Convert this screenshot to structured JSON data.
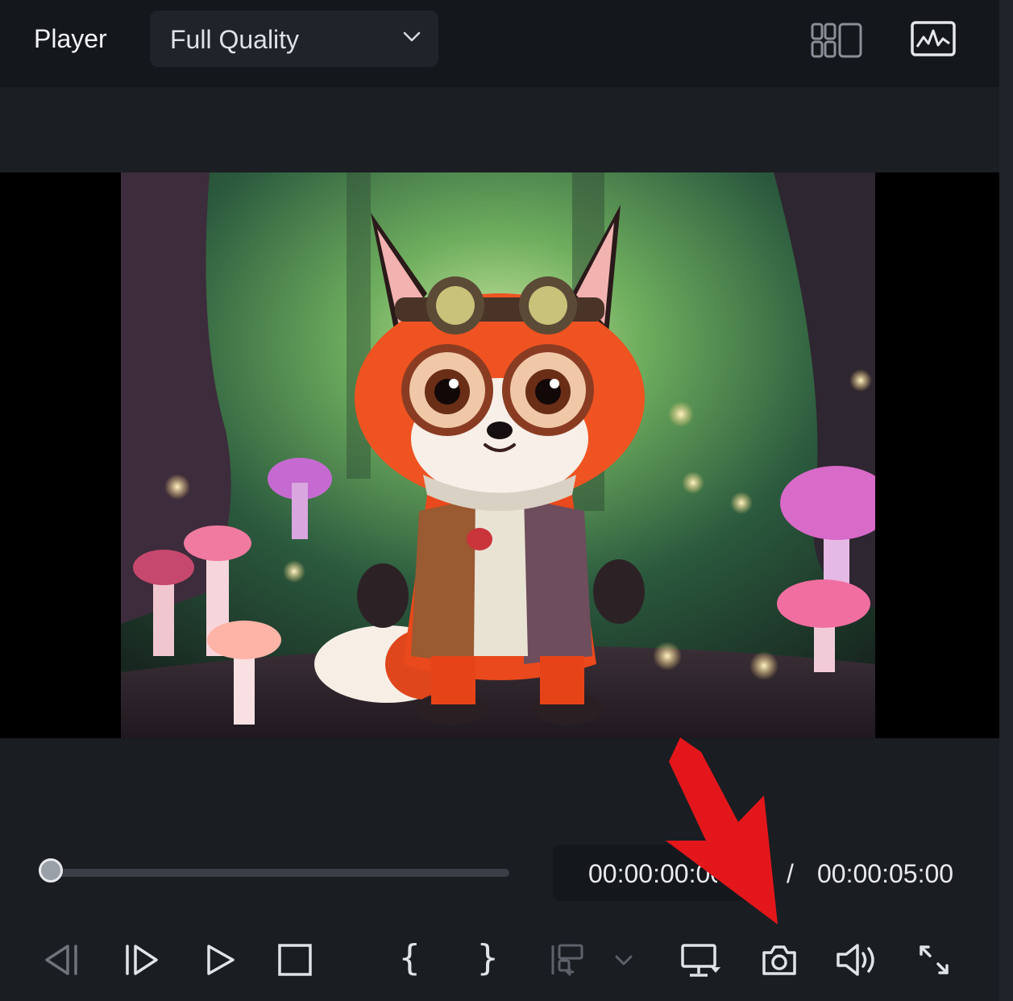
{
  "header": {
    "title": "Player",
    "quality": {
      "selected": "Full Quality"
    },
    "icons": [
      "grid-layout-icon",
      "waveform-image-icon"
    ]
  },
  "playback": {
    "current_time": "00:00:00:00",
    "separator": "/",
    "total_time": "00:00:05:00",
    "progress": 0.0
  },
  "controls": {
    "mark_in": "{",
    "mark_out": "}",
    "icons": [
      "previous-frame-icon",
      "next-frame-icon",
      "play-icon",
      "stop-icon",
      "insert-clip-icon",
      "display-settings-icon",
      "snapshot-camera-icon",
      "volume-icon",
      "fullscreen-icon"
    ]
  },
  "colors": {
    "background": "#1a1d22",
    "topbar": "#14171c",
    "annotation_arrow": "#e3171b"
  }
}
